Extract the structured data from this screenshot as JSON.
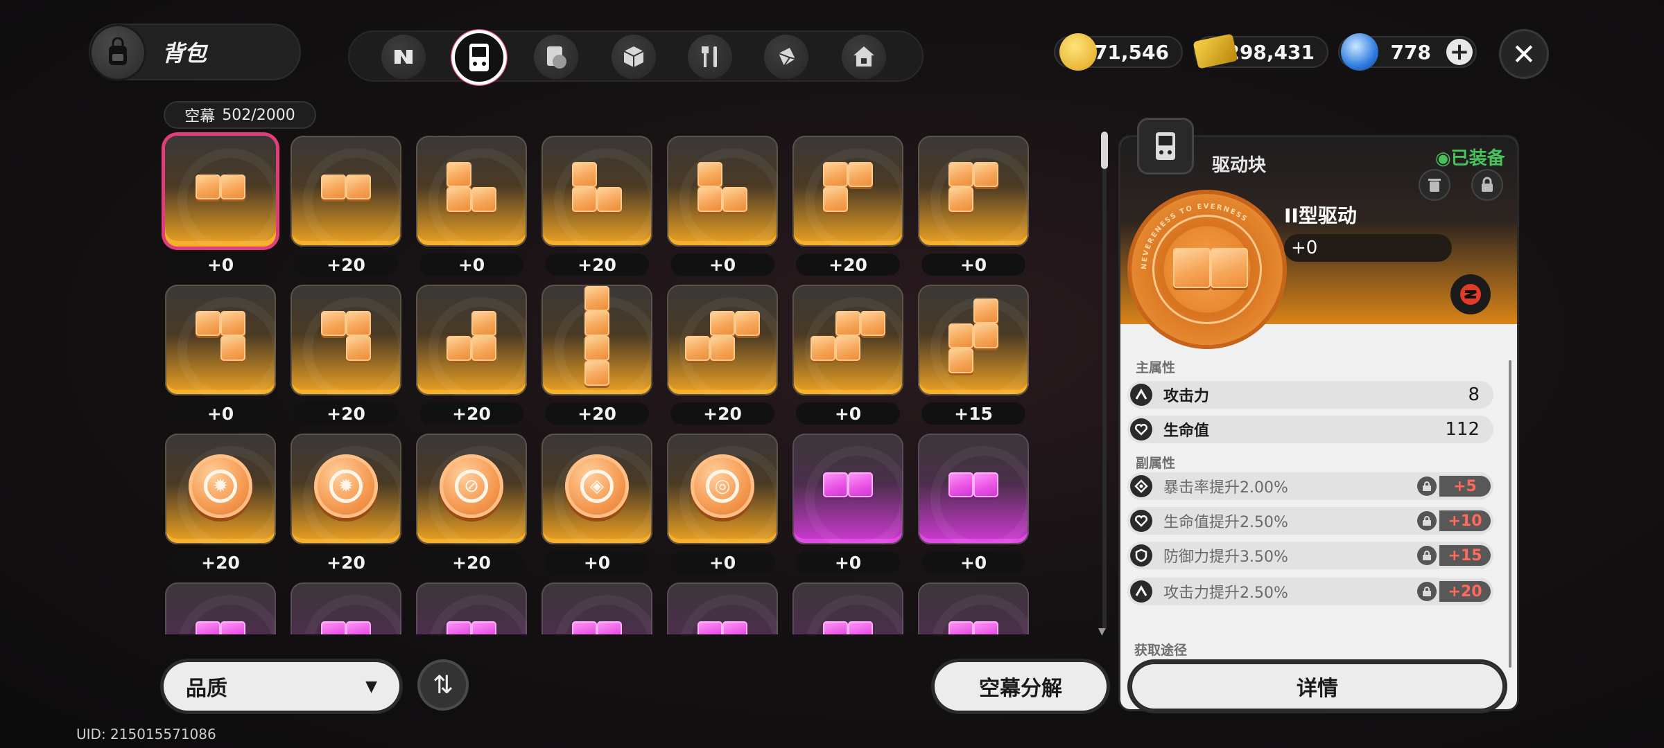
{
  "header": {
    "title": "背包",
    "tabs": [
      {
        "name": "n-logo-icon"
      },
      {
        "name": "drive-disc-icon",
        "active": true
      },
      {
        "name": "engine-icon"
      },
      {
        "name": "box-icon"
      },
      {
        "name": "food-icon"
      },
      {
        "name": "material-icon"
      },
      {
        "name": "home-icon"
      }
    ]
  },
  "currency": {
    "gold": "171,546",
    "ticket": "298,431",
    "gem": "778"
  },
  "inventory": {
    "name": "空幕",
    "count": "502/2000"
  },
  "grid": {
    "rows": [
      [
        {
          "kind": "2h",
          "level": "+0",
          "selected": true
        },
        {
          "kind": "2h",
          "level": "+20"
        },
        {
          "kind": "L",
          "level": "+0"
        },
        {
          "kind": "L",
          "level": "+20"
        },
        {
          "kind": "L",
          "level": "+0"
        },
        {
          "kind": "Gamma",
          "level": "+20"
        },
        {
          "kind": "Gamma",
          "level": "+0"
        }
      ],
      [
        {
          "kind": "J7",
          "level": "+0"
        },
        {
          "kind": "J7",
          "level": "+20"
        },
        {
          "kind": "Jsmall",
          "level": "+20"
        },
        {
          "kind": "I4",
          "level": "+20"
        },
        {
          "kind": "Swide",
          "level": "+20"
        },
        {
          "kind": "Swide",
          "level": "+0"
        },
        {
          "kind": "Stall",
          "level": "+15"
        }
      ],
      [
        {
          "kind": "coin-sun",
          "level": "+20"
        },
        {
          "kind": "coin-sun",
          "level": "+20"
        },
        {
          "kind": "coin-compass",
          "level": "+20"
        },
        {
          "kind": "coin-diamond",
          "level": "+0"
        },
        {
          "kind": "coin-ring",
          "level": "+0"
        },
        {
          "kind": "2h-purple",
          "level": "+0"
        },
        {
          "kind": "2h-purple",
          "level": "+0"
        }
      ],
      [
        {
          "kind": "2h-purple",
          "level": ""
        },
        {
          "kind": "2h-purple",
          "level": ""
        },
        {
          "kind": "2h-purple",
          "level": ""
        },
        {
          "kind": "2h-purple",
          "level": ""
        },
        {
          "kind": "2h-purple",
          "level": ""
        },
        {
          "kind": "2h-purple",
          "level": ""
        },
        {
          "kind": "2h-purple",
          "level": ""
        }
      ]
    ]
  },
  "controls": {
    "sort_label": "品质",
    "salvage_label": "空幕分解",
    "uid": "UID: 215015571086"
  },
  "detail": {
    "type": "驱动块",
    "equipped": "◉已装备",
    "disc_ring_text": "NEVERENESS TO EVERNESS",
    "name": "II型驱动",
    "level": "+0",
    "main_label": "主属性",
    "main_stats": [
      {
        "icon": "attack-icon",
        "name": "攻击力",
        "value": "8"
      },
      {
        "icon": "heart-icon",
        "name": "生命值",
        "value": "112"
      }
    ],
    "sub_label": "副属性",
    "sub_stats": [
      {
        "icon": "crit-icon",
        "name": "暴击率提升2.00%",
        "value": "+5"
      },
      {
        "icon": "heart-icon",
        "name": "生命值提升2.50%",
        "value": "+10"
      },
      {
        "icon": "shield-icon",
        "name": "防御力提升3.50%",
        "value": "+15"
      },
      {
        "icon": "attack-icon",
        "name": "攻击力提升2.50%",
        "value": "+20"
      }
    ],
    "source_label": "获取途径",
    "detail_btn": "详情"
  },
  "colors": {
    "gold_tile": "#f2a623",
    "purple_tile": "#d33ad8",
    "selected_border": "#e23c7d",
    "equipped": "#48c25c",
    "sub_value": "#ff6a5a"
  }
}
